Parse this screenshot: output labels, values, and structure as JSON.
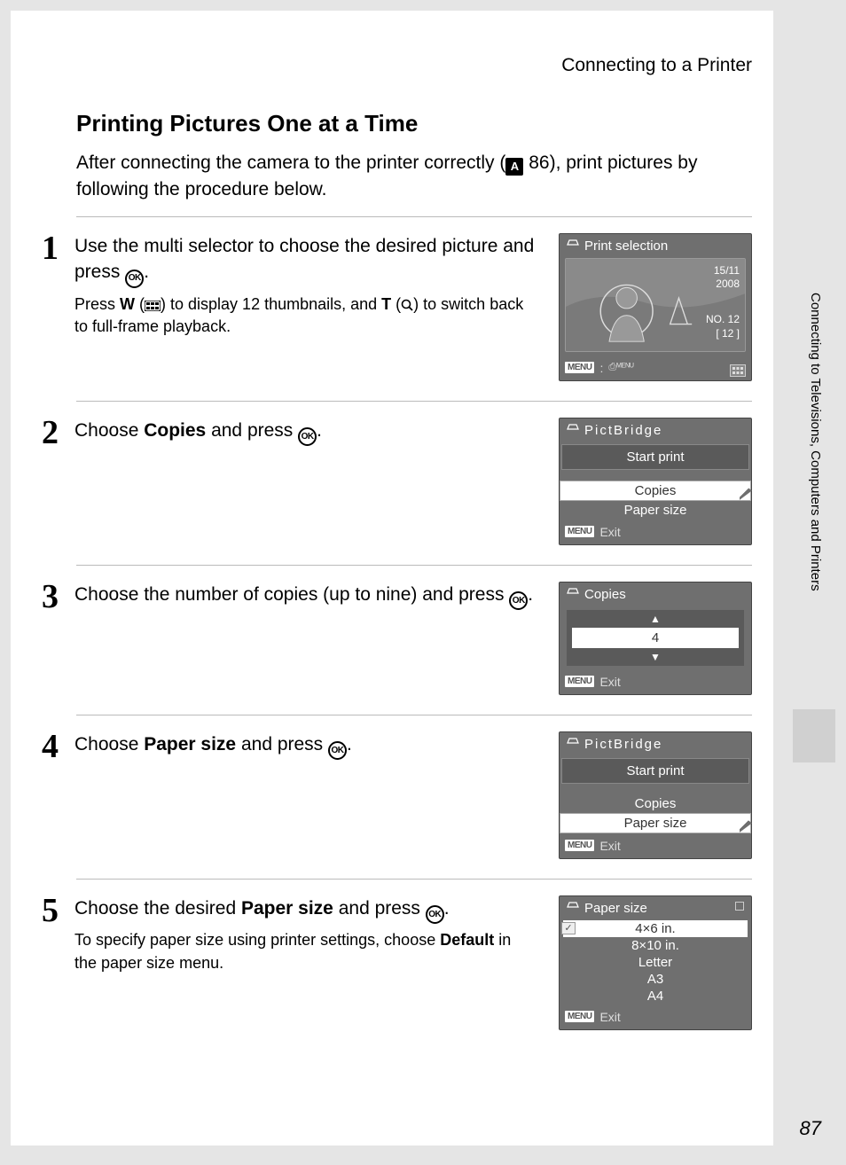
{
  "header": {
    "breadcrumb": "Connecting to a Printer"
  },
  "side_tab": "Connecting to Televisions, Computers and Printers",
  "page_number": "87",
  "title": "Printing Pictures One at a Time",
  "intro": {
    "before_ref": "After connecting the camera to the printer correctly (",
    "ref_num": "86",
    "after_ref": "), print pictures by following the procedure below."
  },
  "steps": [
    {
      "num": "1",
      "title_plain_before": "Use the multi selector to choose the desired picture and press ",
      "title_plain_after": ".",
      "sub_before_w": "Press ",
      "sub_w": "W",
      "sub_mid1": " (",
      "sub_mid2": ") to display 12 thumbnails, and ",
      "sub_t": "T",
      "sub_mid3": " (",
      "sub_mid4": ") to switch back to full-frame playback.",
      "lcd": {
        "title": "Print selection",
        "date": "15/11",
        "year": "2008",
        "no": "NO. 12",
        "idx": "[   12 ]",
        "footer_menu": "MENU",
        "footer_sub": ""
      }
    },
    {
      "num": "2",
      "title_before_bold": "Choose ",
      "title_bold": "Copies",
      "title_after_bold": " and press ",
      "lcd": {
        "title": "PictBridge",
        "item_start": "Start print",
        "item_copies": "Copies",
        "item_paper": "Paper size",
        "footer_menu": "MENU",
        "footer_exit": "Exit"
      }
    },
    {
      "num": "3",
      "title_plain_before": "Choose the number of copies (up to nine) and press ",
      "title_plain_after": ".",
      "lcd": {
        "title": "Copies",
        "value": "4",
        "footer_menu": "MENU",
        "footer_exit": "Exit"
      }
    },
    {
      "num": "4",
      "title_before_bold": "Choose ",
      "title_bold": "Paper size",
      "title_after_bold": " and press ",
      "lcd": {
        "title": "PictBridge",
        "item_start": "Start print",
        "item_copies": "Copies",
        "item_paper": "Paper size",
        "footer_menu": "MENU",
        "footer_exit": "Exit"
      }
    },
    {
      "num": "5",
      "title_before_bold": "Choose the desired ",
      "title_bold": "Paper size",
      "title_after_bold": " and press ",
      "sub_before_bold": "To specify paper size using printer settings, choose ",
      "sub_bold": "Default",
      "sub_after_bold": " in the paper size menu.",
      "lcd": {
        "title": "Paper size",
        "items": [
          "4×6 in.",
          "8×10 in.",
          "Letter",
          "A3",
          "A4"
        ],
        "footer_menu": "MENU",
        "footer_exit": "Exit"
      }
    }
  ]
}
